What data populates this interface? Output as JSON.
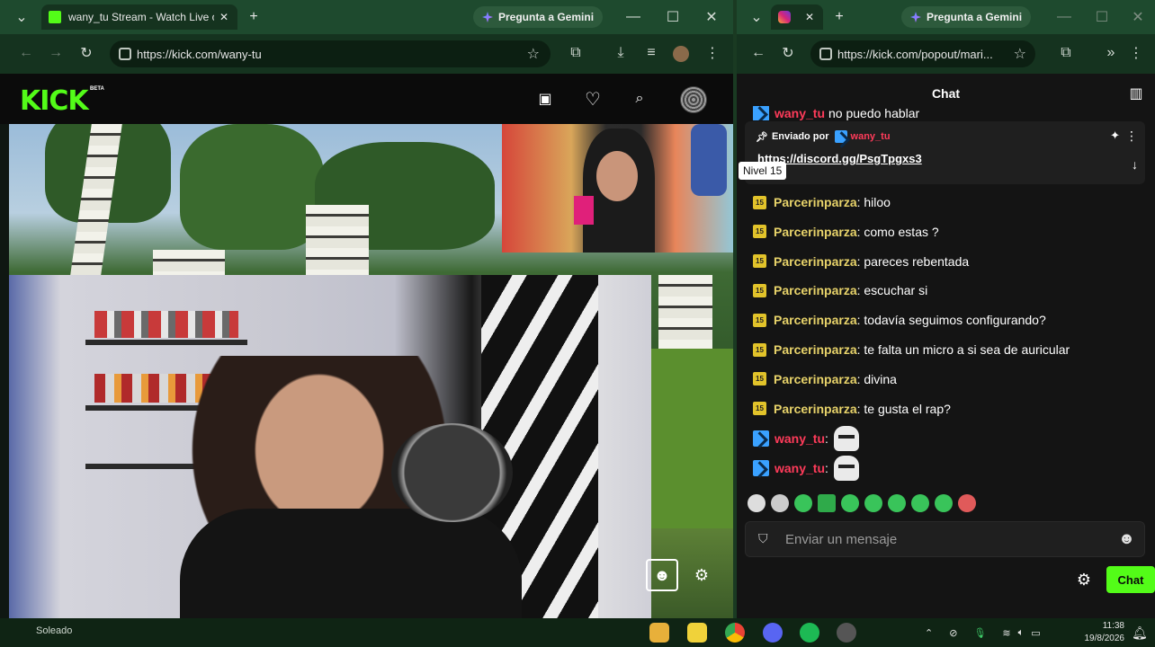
{
  "left_browser": {
    "tab_title": "wany_tu Stream - Watch Live o",
    "gemini_label": "Pregunta a Gemini",
    "url": "https://kick.com/wany-tu"
  },
  "right_browser": {
    "gemini_label": "Pregunta a Gemini",
    "url": "https://kick.com/popout/mari..."
  },
  "kick": {
    "logo": "KICK",
    "beta": "BETA"
  },
  "chat": {
    "header_title": "Chat",
    "partial_top_message": {
      "user": "wany_tu",
      "text": "no puedo hablar"
    },
    "pinned": {
      "prefix": "Enviado por",
      "user": "wany_tu",
      "link": "https://discord.gg/PsgTpgxs3",
      "tooltip": "Nivel 15"
    },
    "messages": [
      {
        "badge": "15",
        "user": "Parcerinparza",
        "text": "hiloo"
      },
      {
        "badge": "15",
        "user": "Parcerinparza",
        "text": "como estas ?"
      },
      {
        "badge": "15",
        "user": "Parcerinparza",
        "text": "pareces rebentada"
      },
      {
        "badge": "15",
        "user": "Parcerinparza",
        "text": "escuchar si"
      },
      {
        "badge": "15",
        "user": "Parcerinparza",
        "text": "todavía seguimos configurando?"
      },
      {
        "badge": "15",
        "user": "Parcerinparza",
        "text": "te falta un micro a si sea de auricular"
      },
      {
        "badge": "15",
        "user": "Parcerinparza",
        "text": "divina"
      },
      {
        "badge": "15",
        "user": "Parcerinparza",
        "text": "te gusta el rap?"
      }
    ],
    "streamer_messages": [
      {
        "user": "wany_tu",
        "emote": "emote"
      },
      {
        "user": "wany_tu",
        "emote": "emote"
      }
    ],
    "input_placeholder": "Enviar un mensaje",
    "send_label": "Chat"
  },
  "taskbar": {
    "weather": "Soleado",
    "time": "11:38",
    "date": "19/8/2026"
  },
  "colors": {
    "kick_green": "#53fc18",
    "badge_yellow": "#e2c32a",
    "streamer_red": "#ff3b5a",
    "chrome_green": "#1e4a2e"
  }
}
